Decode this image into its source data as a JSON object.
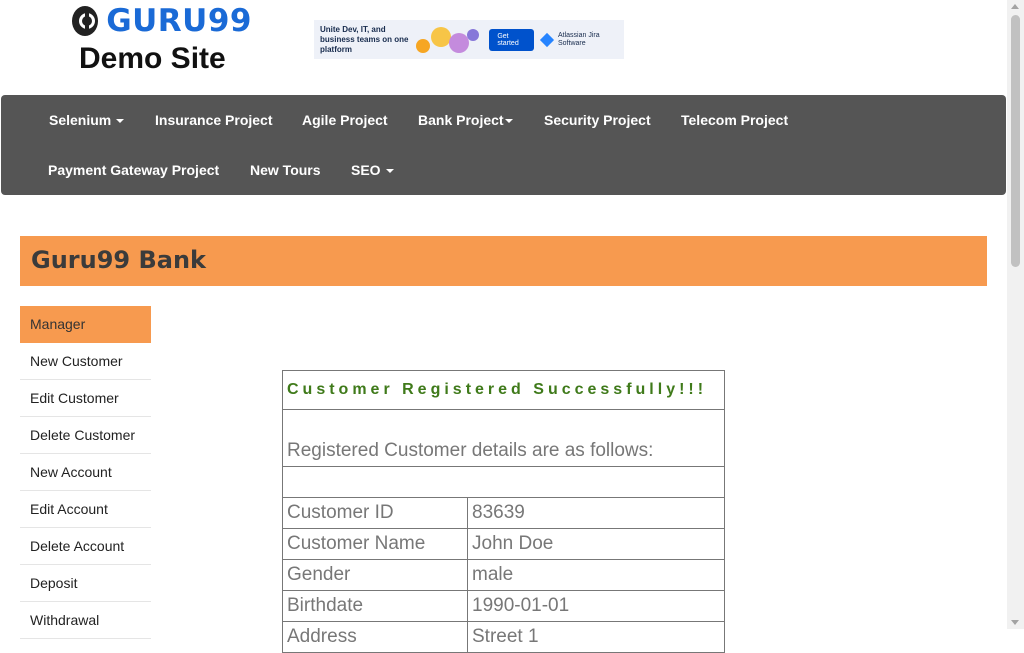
{
  "brand": {
    "logo_text": "GURU99",
    "subtitle": "Demo Site"
  },
  "ad": {
    "text": "Unite Dev, IT, and business teams on one platform",
    "cta": "Get started",
    "vendor": "Atlassian Jira Software"
  },
  "nav": {
    "items": [
      {
        "label": "Selenium",
        "dropdown": true
      },
      {
        "label": "Insurance Project",
        "dropdown": false
      },
      {
        "label": "Agile Project",
        "dropdown": false
      },
      {
        "label": "Bank Project",
        "dropdown": true
      },
      {
        "label": "Security Project",
        "dropdown": false
      },
      {
        "label": "Telecom Project",
        "dropdown": false
      },
      {
        "label": "Payment Gateway Project",
        "dropdown": false
      },
      {
        "label": "New Tours",
        "dropdown": false
      },
      {
        "label": "SEO",
        "dropdown": true
      }
    ]
  },
  "bank": {
    "title": "Guru99 Bank"
  },
  "sidebar": {
    "items": [
      {
        "label": "Manager"
      },
      {
        "label": "New Customer"
      },
      {
        "label": "Edit Customer"
      },
      {
        "label": "Delete Customer"
      },
      {
        "label": "New Account"
      },
      {
        "label": "Edit Account"
      },
      {
        "label": "Delete Account"
      },
      {
        "label": "Deposit"
      },
      {
        "label": "Withdrawal"
      }
    ]
  },
  "result": {
    "success_message": "Customer Registered Successfully!!!",
    "details_heading": "Registered Customer details are as follows:",
    "rows": [
      {
        "key": "Customer ID",
        "value": "83639"
      },
      {
        "key": "Customer Name",
        "value": "John Doe"
      },
      {
        "key": "Gender",
        "value": "male"
      },
      {
        "key": "Birthdate",
        "value": "1990-01-01"
      },
      {
        "key": "Address",
        "value": "Street 1"
      }
    ]
  },
  "colors": {
    "accent": "#f79a4f",
    "navbar": "#555555",
    "success": "#3f7a1a",
    "brand_blue": "#1a6ad6"
  }
}
